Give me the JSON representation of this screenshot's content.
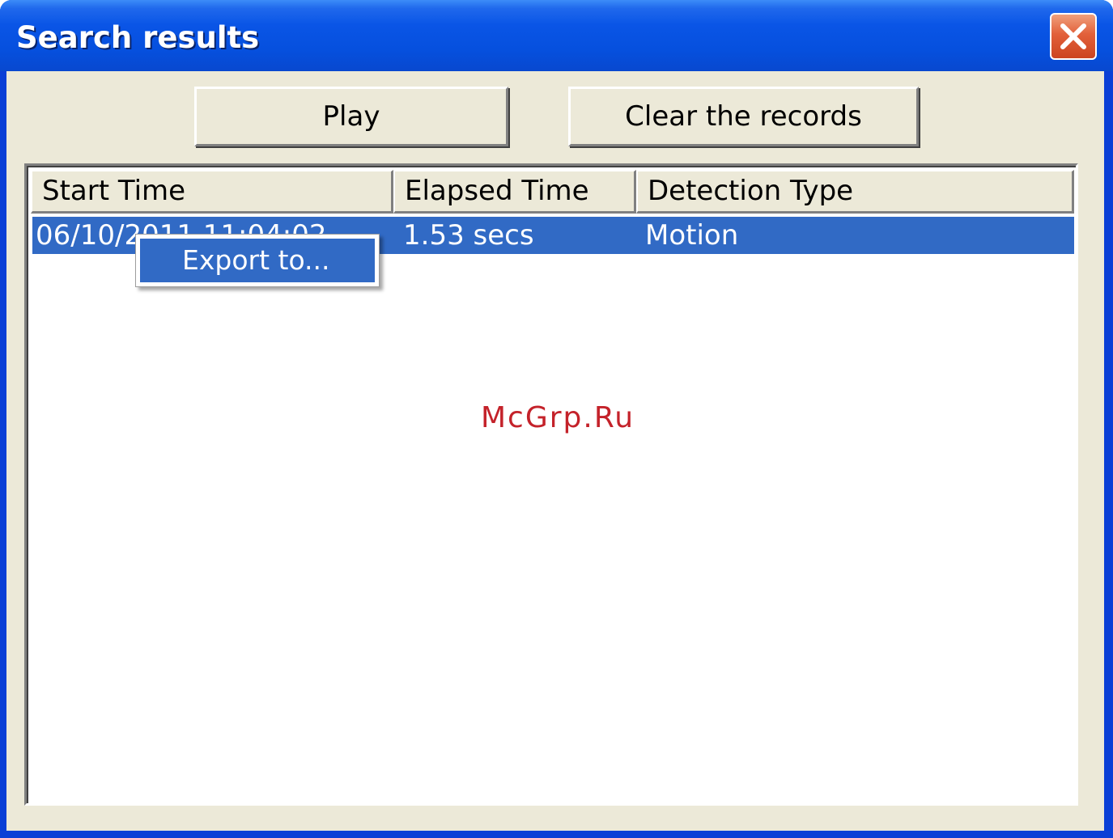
{
  "window": {
    "title": "Search results"
  },
  "toolbar": {
    "play_label": "Play",
    "clear_label": "Clear the records"
  },
  "table": {
    "columns": [
      "Start Time",
      "Elapsed Time",
      "Detection Type"
    ],
    "rows": [
      {
        "start_time": "06/10/2011 11:04:02",
        "elapsed_time": "1.53 secs",
        "detection_type": "Motion",
        "selected": true
      }
    ]
  },
  "context_menu": {
    "items": [
      "Export to..."
    ]
  },
  "watermark": {
    "text": "McGrp.Ru"
  },
  "colors": {
    "titlebar": "#0a55e6",
    "dialog_face": "#ece9d8",
    "selection": "#316ac5",
    "close_button": "#e2603a",
    "watermark": "#c4222a"
  },
  "icons": {
    "close": "close-icon"
  }
}
